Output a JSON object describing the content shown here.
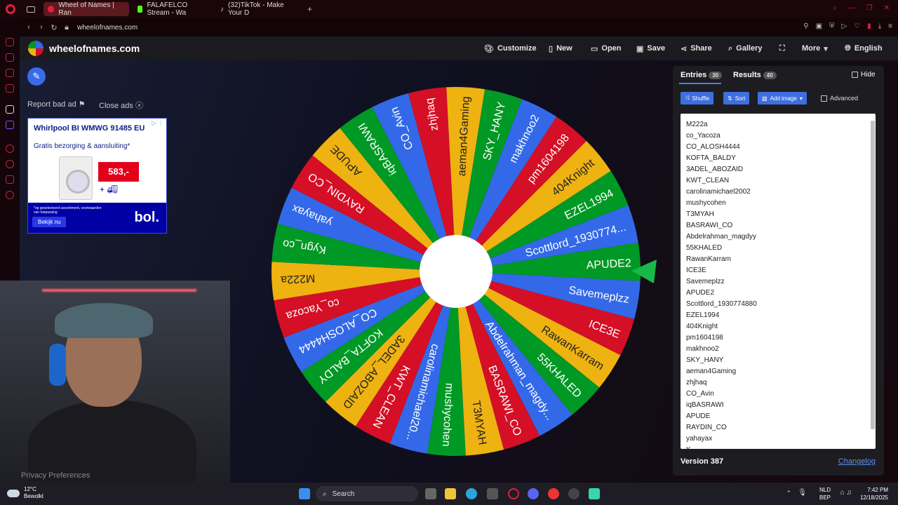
{
  "browser": {
    "tabs": [
      {
        "label": "Wheel of Names | Ran"
      },
      {
        "label": "FALAFELCO Stream - Wa"
      },
      {
        "label": "(32)TikTok - Make Your D"
      }
    ],
    "add_tab": "+",
    "url": "wheelofnames.com"
  },
  "header": {
    "site_name": "wheelofnames.com",
    "menu": {
      "customize": "Customize",
      "new": "New",
      "open": "Open",
      "save": "Save",
      "share": "Share",
      "gallery": "Gallery",
      "more": "More",
      "language": "English"
    }
  },
  "left": {
    "report_ad": "Report bad ad",
    "close_ads": "Close ads",
    "privacy": "Privacy Preferences"
  },
  "ad": {
    "title": "Whirlpool BI WMWG 91485 EU",
    "subtitle": "Gratis bezorging & aansluiting*",
    "price": "583,-",
    "fineprint": "*op geselecteerd assortiment, voorwaarden van toepassing",
    "cta": "Bekijk nu",
    "brand": "bol."
  },
  "wheel": {
    "colors": [
      "#009925",
      "#3369e8",
      "#d50f25",
      "#eeb211"
    ],
    "slices": [
      "APUDE2",
      "Savemeplzz",
      "ICE3E",
      "RawanKarram",
      "55KHALED",
      "Abdelrahman_magdy...",
      "BASRAWI_CO",
      "T3MYAH",
      "mushycohen",
      "carolinamichael20...",
      "KWT_CLEAN",
      "3ADEL_ABOZAID",
      "KOFTA_BALDY",
      "CO_ALOSH4444",
      "co_Yacoza",
      "M222a",
      "Kygn_co",
      "yahayax",
      "RAYDIN_CO",
      "APUDE",
      "iqBASRAWI",
      "CO_Avin",
      "zhjhaq",
      "aeman4Gaming",
      "SKY_HANY",
      "makhnoo2",
      "pm1604198",
      "404Knight",
      "EZEL1994",
      "Scottlord_1930774..."
    ],
    "pointer_color": "#18b84a"
  },
  "panel": {
    "entries_tab": "Entries",
    "entries_count": "30",
    "results_tab": "Results",
    "results_count": "40",
    "hide": "Hide",
    "shuffle": "Shuffle",
    "sort": "Sort",
    "add_image": "Add image",
    "advanced": "Advanced",
    "entries": [
      "M222a",
      "co_Yacoza",
      "CO_ALOSH4444",
      "KOFTA_BALDY",
      "3ADEL_ABOZAID",
      "KWT_CLEAN",
      "carolinamichael2002",
      "mushycohen",
      "T3MYAH",
      "BASRAWI_CO",
      "Abdelrahman_magdyy",
      "55KHALED",
      "RawanKarram",
      "ICE3E",
      "Savemeplzz",
      "APUDE2",
      "Scottlord_1930774880",
      "EZEL1994",
      "404Knight",
      "pm1604198",
      "makhnoo2",
      "SKY_HANY",
      "aeman4Gaming",
      "zhjhaq",
      "CO_Avin",
      "iqBASRAWI",
      "APUDE",
      "RAYDIN_CO",
      "yahayax",
      "K"
    ],
    "version": "Version 387",
    "changelog": "Changelog"
  },
  "taskbar": {
    "temp": "12°C",
    "weather": "Bewolkt",
    "search": "Search",
    "lang1": "NLD",
    "lang2": "BEP",
    "time": "7:42 PM",
    "date": "12/18/2025"
  }
}
